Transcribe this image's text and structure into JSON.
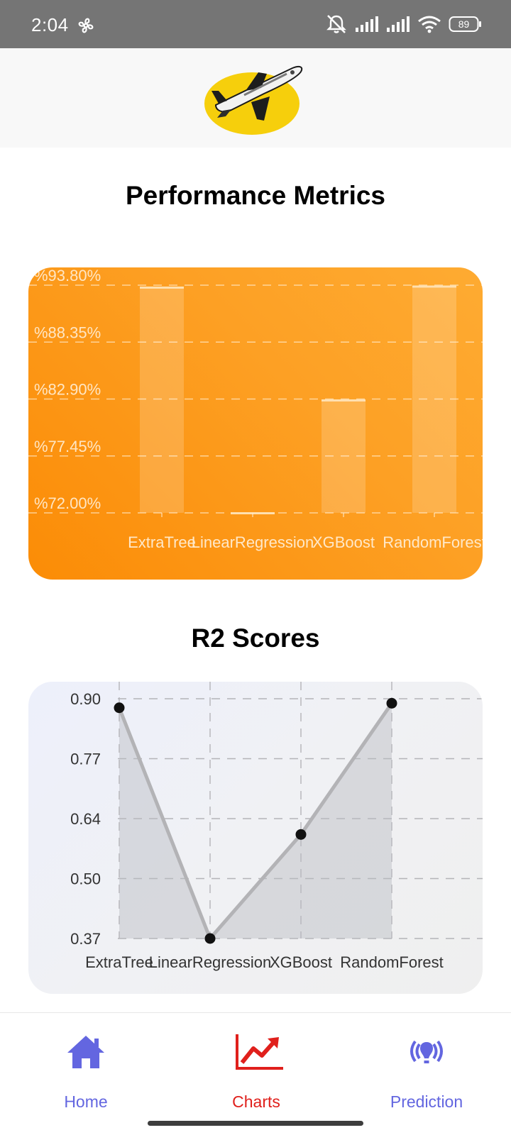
{
  "status_bar": {
    "time": "2:04",
    "battery": "89",
    "icons": [
      "fan-icon",
      "mute-icon",
      "signal-icon",
      "signal-icon",
      "wifi-icon",
      "battery-icon"
    ]
  },
  "header": {
    "logo_icon": "airplane-logo"
  },
  "sections": {
    "performance_title": "Performance Metrics",
    "r2_title": "R2 Scores"
  },
  "chart_data": [
    {
      "type": "bar",
      "title": "Performance Metrics",
      "categories": [
        "ExtraTree",
        "LinearRegression",
        "XGBoost",
        "RandomForest"
      ],
      "values": [
        93.6,
        72.0,
        82.8,
        93.7
      ],
      "y_ticks": [
        "%93.80%",
        "%88.35%",
        "%82.90%",
        "%77.45%",
        "%72.00%"
      ],
      "ylim": [
        72.0,
        93.8
      ],
      "grid": true,
      "colors": {
        "background_start": "#fb8c06",
        "background_end": "#feab32",
        "bar_fill": "rgba(255,255,255,0.18)",
        "bar_cap": "#ffe0b0"
      }
    },
    {
      "type": "area",
      "title": "R2 Scores",
      "categories": [
        "ExtraTree",
        "LinearRegression",
        "XGBoost",
        "RandomForest"
      ],
      "values": [
        0.88,
        0.37,
        0.6,
        0.89
      ],
      "y_ticks": [
        "0.90",
        "0.77",
        "0.64",
        "0.50",
        "0.37"
      ],
      "ylim": [
        0.37,
        0.9
      ],
      "grid": true,
      "colors": {
        "line": "#b3b3b6",
        "fill": "rgba(185,186,194,0.45)",
        "point": "#111111"
      }
    }
  ],
  "bottom_nav": {
    "items": [
      {
        "label": "Home",
        "icon": "home-icon",
        "color": "#6366e0"
      },
      {
        "label": "Charts",
        "icon": "chart-icon",
        "color": "#e0201c",
        "active": true
      },
      {
        "label": "Prediction",
        "icon": "broadcast-icon",
        "color": "#6366e0"
      }
    ]
  }
}
